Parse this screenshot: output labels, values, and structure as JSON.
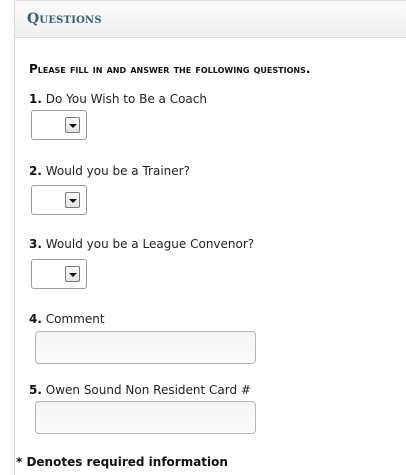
{
  "section": {
    "title": "Questions",
    "instructions": "Please fill in and answer the following questions."
  },
  "questions": [
    {
      "number": "1.",
      "label": "Do You Wish to Be a Coach",
      "type": "select",
      "value": ""
    },
    {
      "number": "2.",
      "label": "Would you be a Trainer?",
      "type": "select",
      "value": ""
    },
    {
      "number": "3.",
      "label": "Would you be a League Convenor?",
      "type": "select",
      "value": ""
    },
    {
      "number": "4.",
      "label": "Comment",
      "type": "text",
      "value": ""
    },
    {
      "number": "5.",
      "label": "Owen Sound Non Resident Card #",
      "type": "text",
      "value": ""
    }
  ],
  "footer": {
    "required_note": "* Denotes required information"
  },
  "icons": {
    "dropdown": "chevron-down-icon"
  },
  "colors": {
    "title": "#2f5f7e",
    "header_bg": "#f3f3f3",
    "field_border": "#b5b5b5"
  }
}
